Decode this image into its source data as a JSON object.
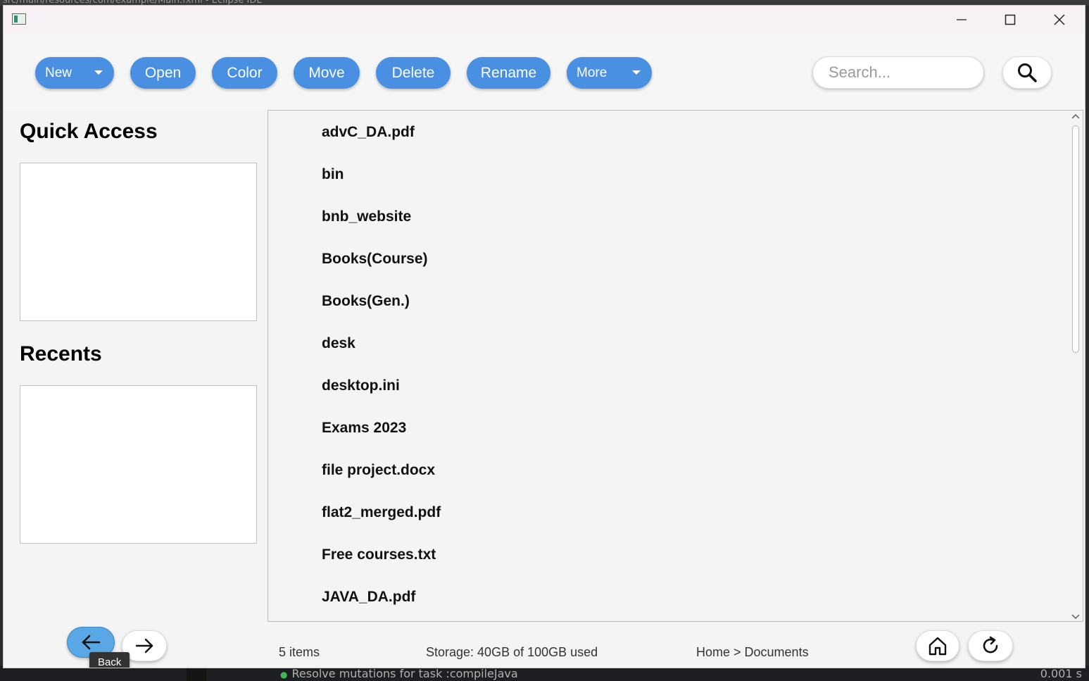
{
  "background_window": {
    "title_fragment": "src/main/resources/com/example/Main.fxml - Eclipse IDE",
    "console_status": "Resolve mutations for task :compileJava",
    "console_time": "0.001 s"
  },
  "window": {
    "controls": [
      "minimize-icon",
      "maximize-icon",
      "close-icon"
    ]
  },
  "toolbar": {
    "new_label": "New",
    "open_label": "Open",
    "color_label": "Color",
    "move_label": "Move",
    "delete_label": "Delete",
    "rename_label": "Rename",
    "more_label": "More",
    "search_placeholder": "Search...",
    "search_icon": "search-icon"
  },
  "sidebar": {
    "quick_access_title": "Quick Access",
    "recents_title": "Recents"
  },
  "files": [
    "advC_DA.pdf",
    "bin",
    "bnb_website",
    "Books(Course)",
    "Books(Gen.)",
    "desk",
    "desktop.ini",
    "Exams 2023",
    "file project.docx",
    "flat2_merged.pdf",
    "Free courses.txt",
    "JAVA_DA.pdf"
  ],
  "statusbar": {
    "item_count": "5 items",
    "storage": "Storage: 40GB of 100GB used",
    "breadcrumb": "Home > Documents",
    "back_tooltip": "Back",
    "icons": [
      "back-arrow-icon",
      "forward-arrow-icon",
      "home-icon",
      "refresh-icon"
    ]
  },
  "colors": {
    "accent": "#4a90e2",
    "back_button": "#5aa7e6",
    "window_bg": "#f4f4f4"
  }
}
